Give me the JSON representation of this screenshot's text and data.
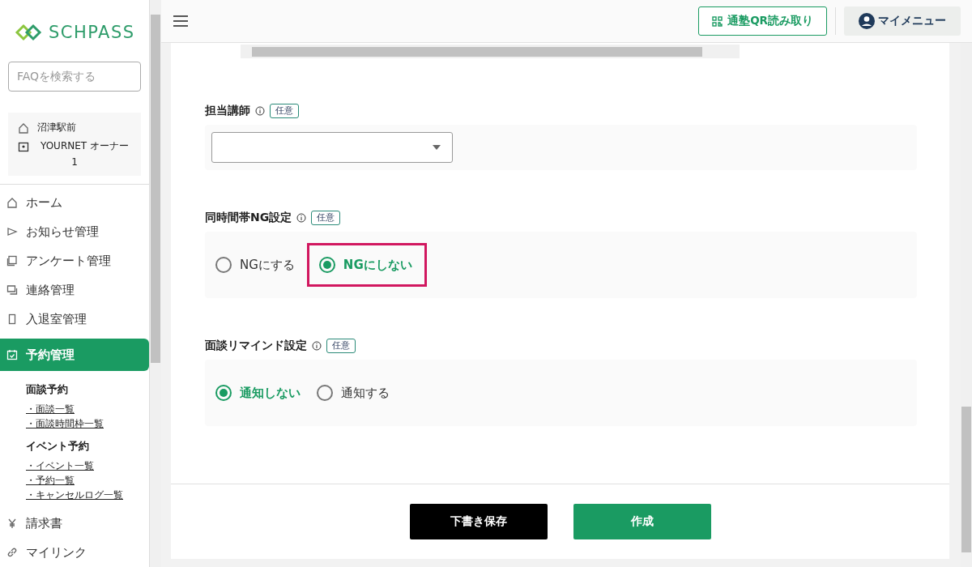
{
  "sidebar": {
    "logo": "SCHPASS",
    "search": {
      "placeholder": "FAQを検索する"
    },
    "account": {
      "school": "沼津駅前",
      "user": "YOURNET オーナー",
      "user_line2": "1"
    },
    "nav": [
      {
        "kind": "home",
        "label": "ホーム",
        "selected": false
      },
      {
        "kind": "notice",
        "label": "お知らせ管理",
        "selected": false
      },
      {
        "kind": "survey",
        "label": "アンケート管理",
        "selected": false
      },
      {
        "kind": "contact",
        "label": "連絡管理",
        "selected": false
      },
      {
        "kind": "door",
        "label": "入退室管理",
        "selected": false
      },
      {
        "kind": "calendar",
        "label": "予約管理",
        "selected": true,
        "groups": [
          {
            "title": "面談予約",
            "links": [
              "・面談一覧",
              "・面談時間枠一覧"
            ]
          },
          {
            "title": "イベント予約",
            "links": [
              "・イベント一覧",
              "・予約一覧",
              "・キャンセルログ一覧"
            ]
          }
        ]
      },
      {
        "kind": "yen",
        "label": "請求書",
        "selected": false
      },
      {
        "kind": "link",
        "label": "マイリンク",
        "selected": false
      }
    ]
  },
  "header": {
    "qr_button": "通塾QR読み取り",
    "menu_button": "マイメニュー"
  },
  "fields": [
    {
      "kind": "select",
      "label": "担当講師",
      "badge": "任意"
    },
    {
      "kind": "radio",
      "label": "同時間帯NG設定",
      "badge": "任意",
      "options": [
        {
          "label": "NGにする",
          "selected": false,
          "highlighted": false
        },
        {
          "label": "NGにしない",
          "selected": true,
          "highlighted": true
        }
      ]
    },
    {
      "kind": "radio",
      "label": "面談リマインド設定",
      "badge": "任意",
      "options": [
        {
          "label": "通知しない",
          "selected": true,
          "highlighted": false
        },
        {
          "label": "通知する",
          "selected": false,
          "highlighted": false
        }
      ]
    }
  ],
  "actions": {
    "draft": "下書き保存",
    "create": "作成"
  }
}
